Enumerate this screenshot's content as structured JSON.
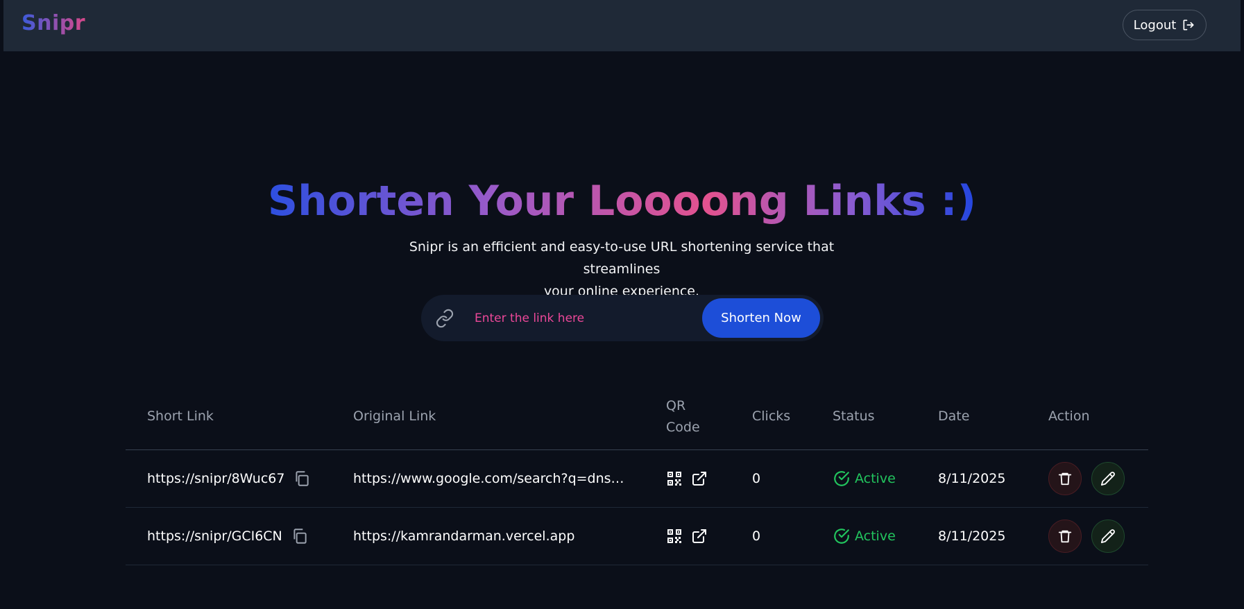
{
  "navbar": {
    "logo": "Snipr",
    "logout_label": "Logout"
  },
  "hero": {
    "title": "Shorten Your Loooong Links :)",
    "subtitle_line1": "Snipr is an efficient and easy-to-use URL shortening service that streamlines",
    "subtitle_line2": "your online experience."
  },
  "form": {
    "placeholder": "Enter the link here",
    "value": "",
    "button_label": "Shorten Now"
  },
  "table": {
    "headers": {
      "short_link": "Short Link",
      "original_link": "Original Link",
      "qr_line1": "QR",
      "qr_line2": "Code",
      "clicks": "Clicks",
      "status": "Status",
      "date": "Date",
      "action": "Action"
    },
    "rows": [
      {
        "short_link": "https://snipr/8Wuc67",
        "original_link": "https://www.google.com/search?q=dns…",
        "clicks": "0",
        "status": "Active",
        "date": "8/11/2025"
      },
      {
        "short_link": "https://snipr/GCI6CN",
        "original_link": "https://kamrandarman.vercel.app",
        "clicks": "0",
        "status": "Active",
        "date": "8/11/2025"
      }
    ]
  },
  "icons": {
    "logout": "logout-icon",
    "link": "link-icon",
    "copy": "copy-icon",
    "qr": "qr-code-icon",
    "external": "external-link-icon",
    "status": "check-circle-icon",
    "delete": "trash-icon",
    "edit": "pencil-icon"
  },
  "colors": {
    "background": "#0b0f19",
    "navbar": "#1f2937",
    "primary_button": "#1d4ed8",
    "placeholder": "#ec4899",
    "status_active": "#22c55e",
    "gradient_start": "#2d4fe0",
    "gradient_mid": "#e3528f"
  }
}
